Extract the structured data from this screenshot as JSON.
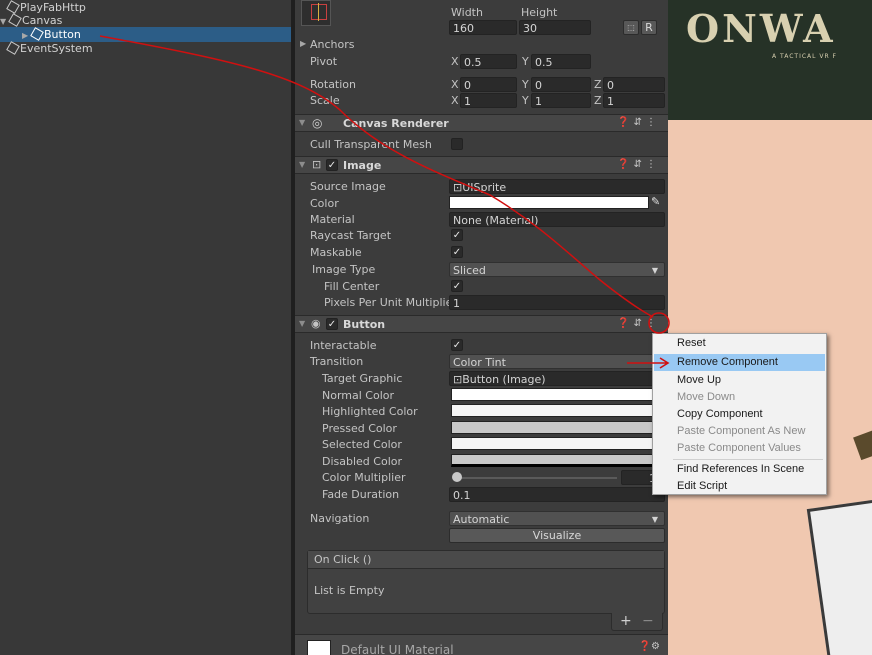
{
  "hierarchy": {
    "items": [
      {
        "label": "PlayFabHttp"
      },
      {
        "label": "Canvas"
      },
      {
        "label": "Button"
      },
      {
        "label": "EventSystem"
      }
    ]
  },
  "rect_transform": {
    "width_label": "Width",
    "height_label": "Height",
    "width": "160",
    "height": "30",
    "r_button": "R",
    "anchors_label": "Anchors",
    "pivot_label": "Pivot",
    "pivot_x": "0.5",
    "pivot_y": "0.5",
    "rotation_label": "Rotation",
    "rot_x": "0",
    "rot_y": "0",
    "rot_z": "0",
    "scale_label": "Scale",
    "scale_x": "1",
    "scale_y": "1",
    "scale_z": "1",
    "axis_x": "X",
    "axis_y": "Y",
    "axis_z": "Z"
  },
  "canvas_renderer": {
    "title": "Canvas Renderer",
    "cull_label": "Cull Transparent Mesh"
  },
  "image": {
    "title": "Image",
    "source_image_label": "Source Image",
    "source_image": "UISprite",
    "color_label": "Color",
    "material_label": "Material",
    "material": "None (Material)",
    "raycast_label": "Raycast Target",
    "maskable_label": "Maskable",
    "image_type_label": "Image Type",
    "image_type": "Sliced",
    "fill_center_label": "Fill Center",
    "ppu_label": "Pixels Per Unit Multiplier",
    "ppu": "1"
  },
  "button": {
    "title": "Button",
    "interactable_label": "Interactable",
    "transition_label": "Transition",
    "transition": "Color Tint",
    "target_graphic_label": "Target Graphic",
    "target_graphic": "Button (Image)",
    "normal_label": "Normal Color",
    "highlighted_label": "Highlighted Color",
    "pressed_label": "Pressed Color",
    "selected_label": "Selected Color",
    "disabled_label": "Disabled Color",
    "multiplier_label": "Color Multiplier",
    "multiplier": "1",
    "fade_label": "Fade Duration",
    "fade": "0.1",
    "navigation_label": "Navigation",
    "navigation": "Automatic",
    "visualize": "Visualize",
    "onclick_title": "On Click ()",
    "list_empty": "List is Empty",
    "plus": "+",
    "minus": "−"
  },
  "material_footer": {
    "label": "Default UI Material"
  },
  "game_view": {
    "title": "ONWA",
    "subtitle": "A TACTICAL VR F"
  },
  "context_menu": {
    "items": [
      {
        "label": "Reset"
      },
      {
        "label": "Remove Component"
      },
      {
        "label": "Move Up"
      },
      {
        "label": "Move Down"
      },
      {
        "label": "Copy Component"
      },
      {
        "label": "Paste Component As New"
      },
      {
        "label": "Paste Component Values"
      },
      {
        "label": "Find References In Scene"
      },
      {
        "label": "Edit Script"
      }
    ]
  },
  "colors": {
    "selection": "#2c5d87",
    "menu_highlight": "#99c9f3",
    "annotation": "#d01010"
  }
}
